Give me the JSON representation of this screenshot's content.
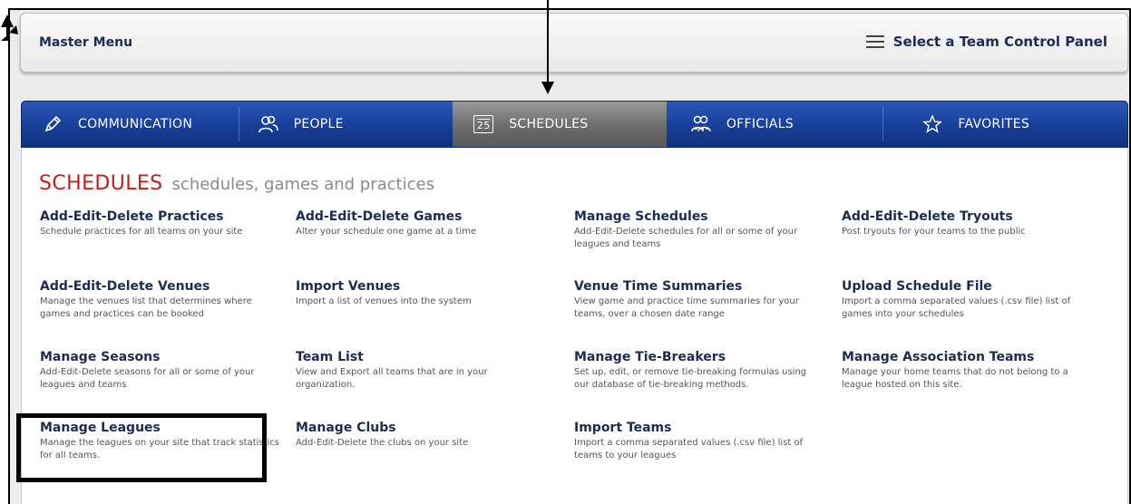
{
  "master_bar": {
    "title": "Master Menu",
    "panel_link": "Select a Team Control Panel"
  },
  "nav": {
    "tabs": [
      {
        "label": "COMMUNICATION",
        "icon": "pencil-icon"
      },
      {
        "label": "PEOPLE",
        "icon": "people-icon"
      },
      {
        "label": "SCHEDULES",
        "icon": "calendar-icon",
        "icon_text": "25",
        "active": true
      },
      {
        "label": "OFFICIALS",
        "icon": "officials-icon"
      },
      {
        "label": "FAVORITES",
        "icon": "star-icon"
      }
    ]
  },
  "section": {
    "title": "SCHEDULES",
    "subtitle": "schedules, games and practices"
  },
  "items": [
    {
      "title": "Add-Edit-Delete Practices",
      "desc": "Schedule practices for all teams on your site"
    },
    {
      "title": "Add-Edit-Delete Games",
      "desc": "Alter your schedule one game at a time"
    },
    {
      "title": "Manage Schedules",
      "desc": "Add-Edit-Delete schedules for all or some of your leagues and teams"
    },
    {
      "title": "Add-Edit-Delete Tryouts",
      "desc": "Post tryouts for your teams to the public"
    },
    {
      "title": "Add-Edit-Delete Venues",
      "desc": "Manage the venues list that determines where games and practices can be booked"
    },
    {
      "title": "Import Venues",
      "desc": "Import a list of venues into the system"
    },
    {
      "title": "Venue Time Summaries",
      "desc": "View game and practice time summaries for your teams, over a chosen date range"
    },
    {
      "title": "Upload Schedule File",
      "desc": "Import a comma separated values (.csv file) list of games into your schedules"
    },
    {
      "title": "Manage Seasons",
      "desc": "Add-Edit-Delete seasons for all or some of your leagues and teams"
    },
    {
      "title": "Team List",
      "desc": "View and Export all teams that are in your organization."
    },
    {
      "title": "Manage Tie-Breakers",
      "desc": "Set up, edit, or remove tie-breaking formulas using our database of tie-breaking methods."
    },
    {
      "title": "Manage Association Teams",
      "desc": "Manage your home teams that do not belong to a league hosted on this site."
    },
    {
      "title": "Manage Leagues",
      "desc": "Manage the leagues on your site that track statistics for all teams."
    },
    {
      "title": "Manage Clubs",
      "desc": "Add-Edit-Delete the clubs on your site"
    },
    {
      "title": "Import Teams",
      "desc": "Import a comma separated values (.csv file) list of teams to your leagues"
    }
  ]
}
